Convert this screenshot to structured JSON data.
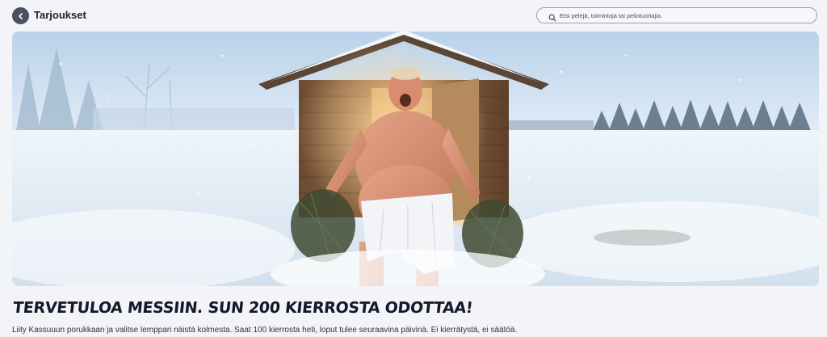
{
  "header": {
    "title": "Tarjoukset",
    "back_icon": "chevron-left-icon"
  },
  "search": {
    "placeholder": "Etsi pelejä, toimintoja tai pelintuottajia.",
    "icon": "search-icon"
  },
  "promo": {
    "headline": "Tervetuloa messiin. Sun 200 kierrosta odottaa!",
    "description": "Liity Kassuuun porukkaan ja valitse lemppari näistä kolmesta. Saat 100 kierrosta heti, loput tulee seuraavina päivinä. Ei kierrätystä, ei säätöä."
  },
  "colors": {
    "page_background": "#f3f4f8",
    "title_text": "#1e2130",
    "back_button": "#4b4f5e",
    "search_border": "#9aa0ad"
  }
}
